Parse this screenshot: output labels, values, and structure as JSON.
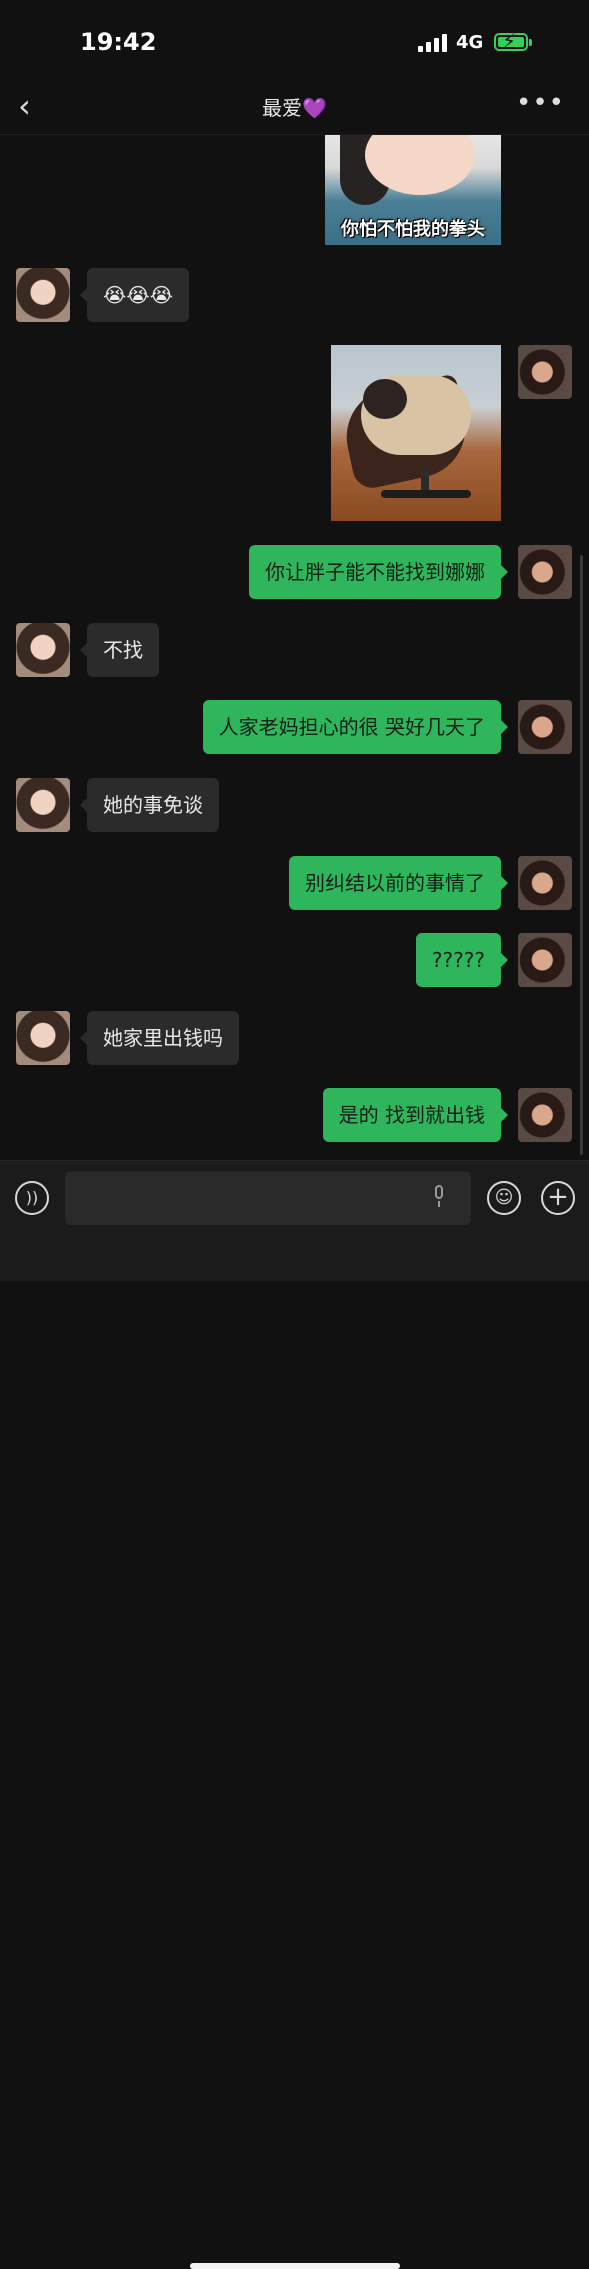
{
  "status_bar": {
    "time": "19:42",
    "network": "4G"
  },
  "header": {
    "title": "最爱💜"
  },
  "colors": {
    "background": "#111111",
    "bubble_out": "#2fb65c",
    "bubble_in": "#2b2b2b"
  },
  "messages": [
    {
      "from": "me",
      "type": "sticker",
      "caption": "你怕不怕我的拳头"
    },
    {
      "from": "her",
      "type": "text",
      "text": "😭😭😭"
    },
    {
      "from": "me",
      "type": "sticker",
      "caption": ""
    },
    {
      "from": "me",
      "type": "text",
      "text": "你让胖子能不能找到娜娜"
    },
    {
      "from": "her",
      "type": "text",
      "text": "不找"
    },
    {
      "from": "me",
      "type": "text",
      "text": "人家老妈担心的很 哭好几天了"
    },
    {
      "from": "her",
      "type": "text",
      "text": "她的事免谈"
    },
    {
      "from": "me",
      "type": "text",
      "text": "别纠结以前的事情了"
    },
    {
      "from": "me",
      "type": "text",
      "text": "?????"
    },
    {
      "from": "her",
      "type": "text",
      "text": "她家里出钱吗"
    },
    {
      "from": "me",
      "type": "text",
      "text": "是的 找到就出钱"
    }
  ],
  "input_bar": {
    "value": ""
  }
}
